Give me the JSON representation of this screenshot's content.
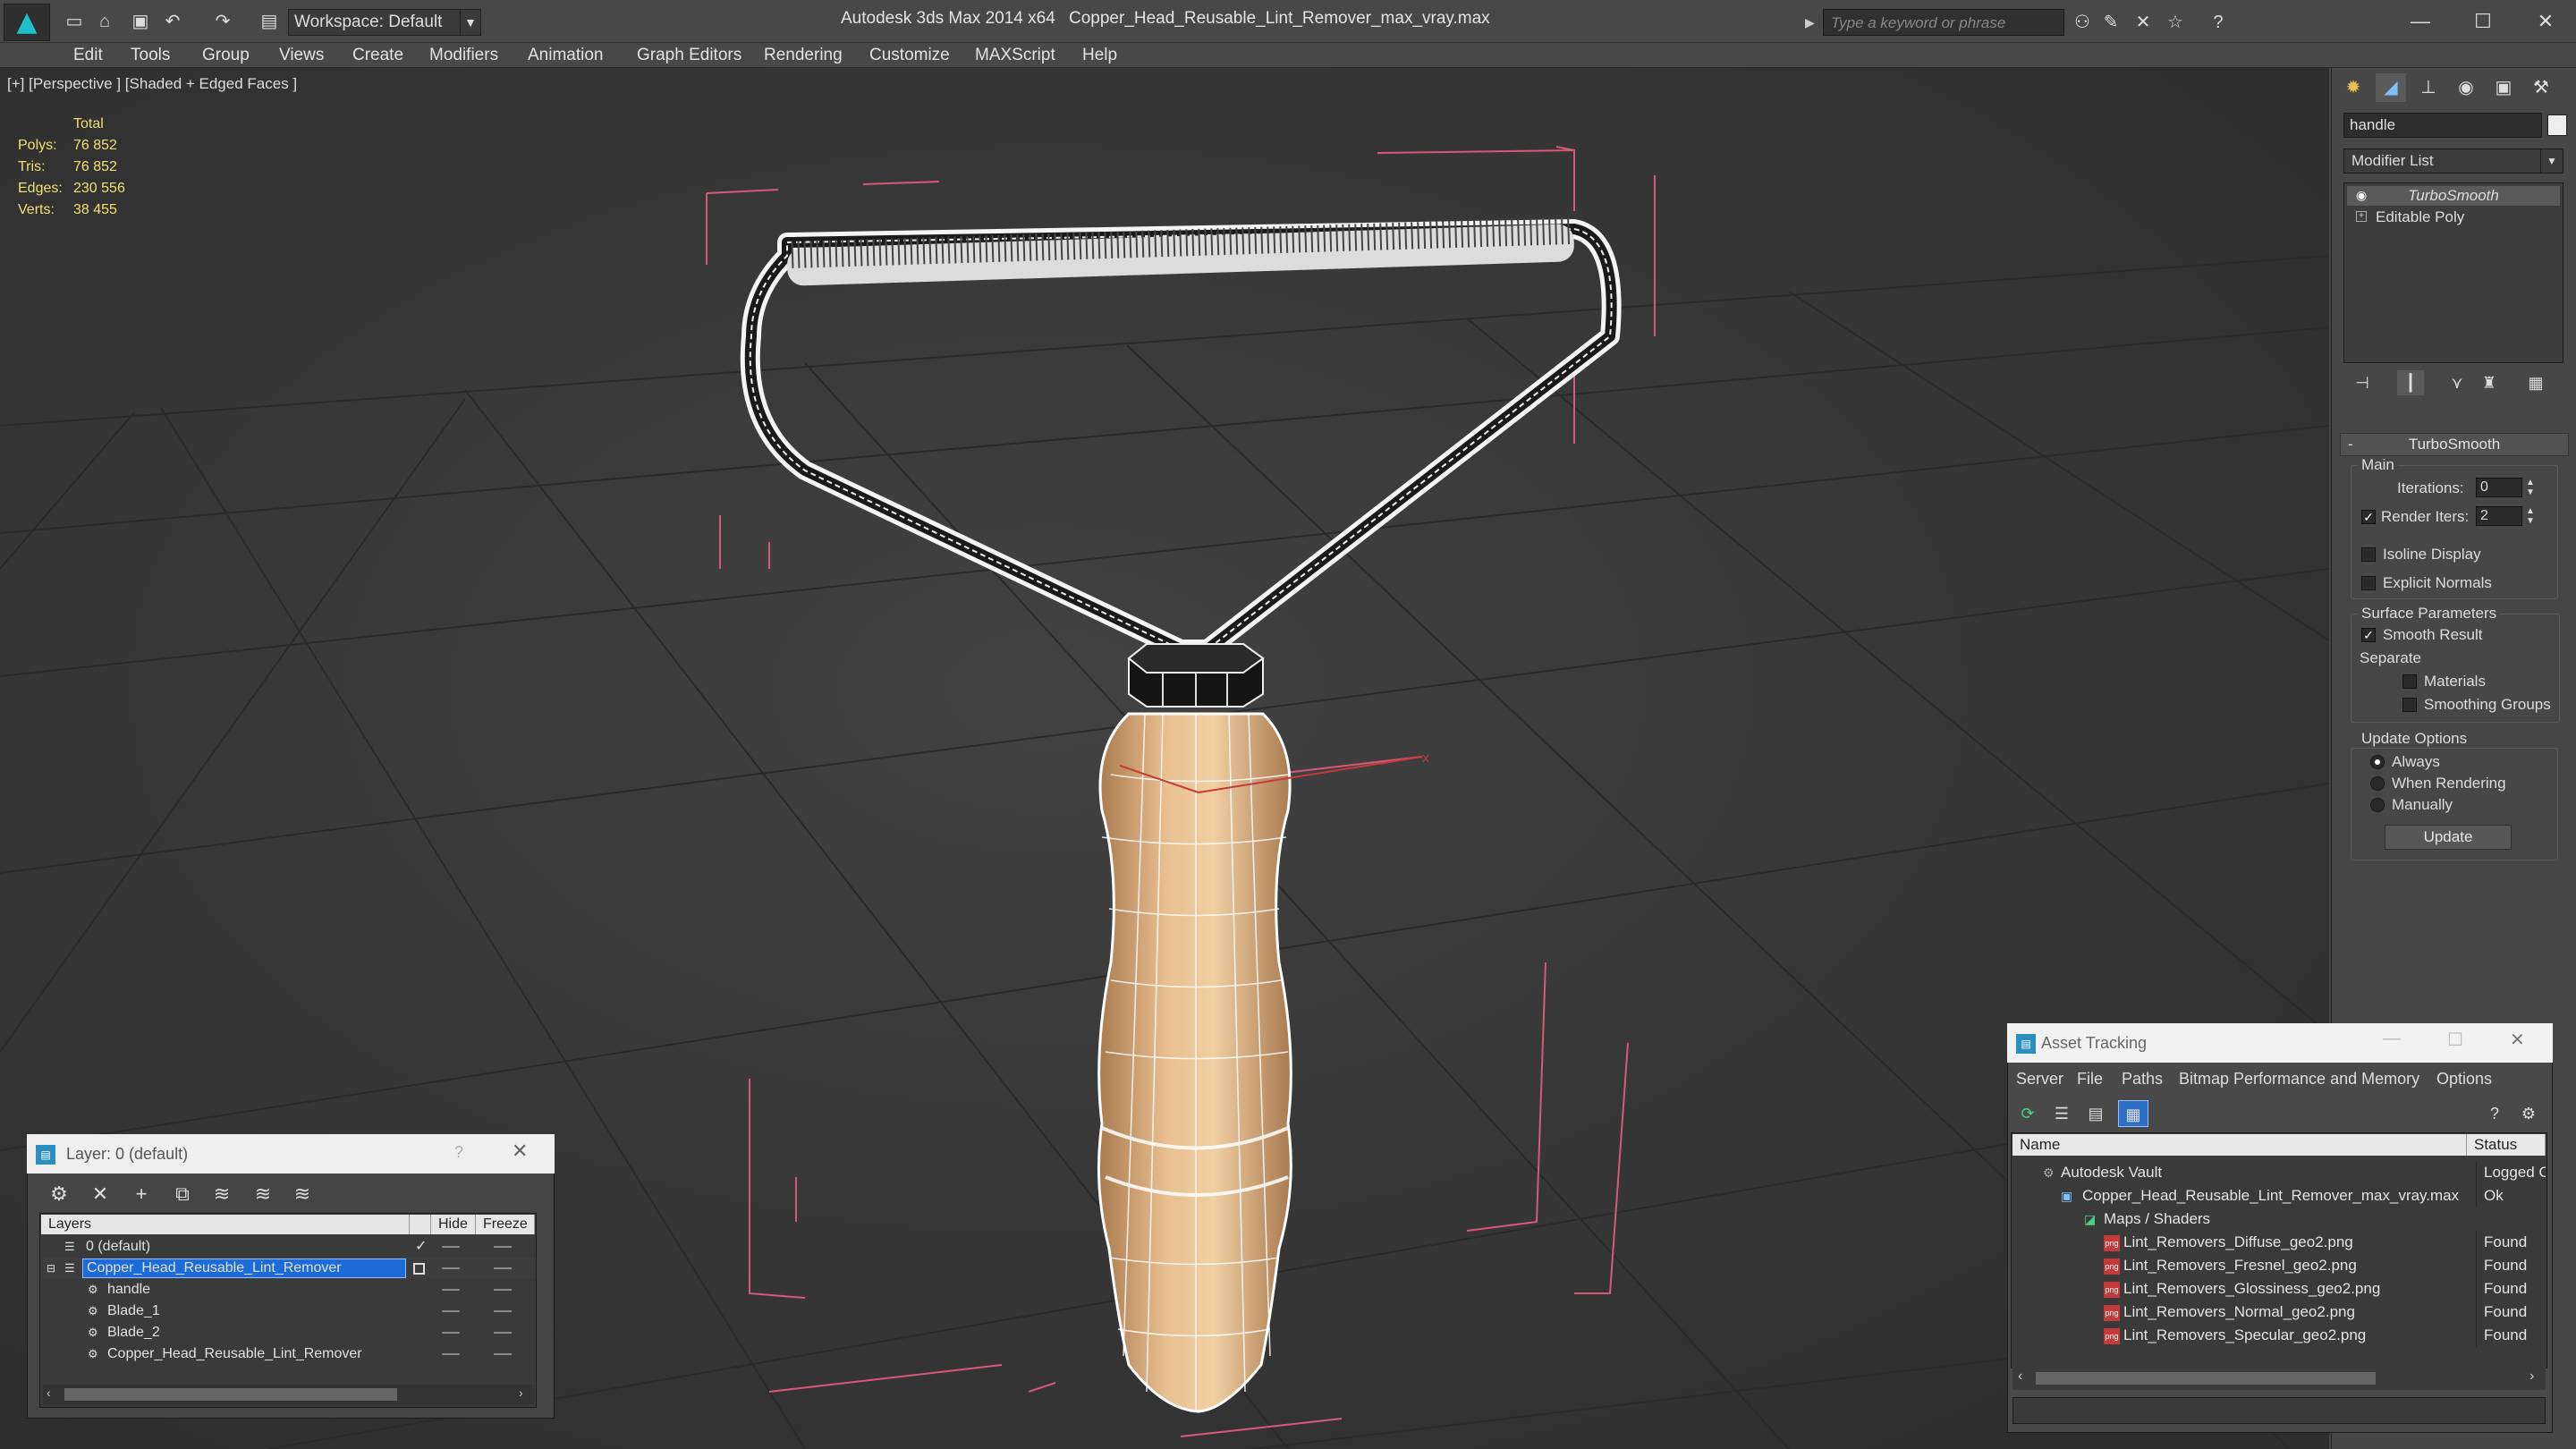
{
  "titlebar": {
    "workspace": "Workspace: Default",
    "app_title": "Autodesk 3ds Max  2014 x64",
    "file_title": "Copper_Head_Reusable_Lint_Remover_max_vray.max",
    "search_placeholder": "Type a keyword or phrase"
  },
  "menu": [
    "Edit",
    "Tools",
    "Group",
    "Views",
    "Create",
    "Modifiers",
    "Animation",
    "Graph Editors",
    "Rendering",
    "Customize",
    "MAXScript",
    "Help"
  ],
  "viewport": {
    "label": "[+] [Perspective ] [Shaded + Edged Faces ]",
    "stats": {
      "header": "Total",
      "rows": [
        {
          "label": "Polys:",
          "value": "76 852"
        },
        {
          "label": "Tris:",
          "value": "76 852"
        },
        {
          "label": "Edges:",
          "value": "230 556"
        },
        {
          "label": "Verts:",
          "value": "38 455"
        }
      ]
    }
  },
  "command_panel": {
    "object_name": "handle",
    "modifier_list": "Modifier List",
    "stack": [
      "TurboSmooth",
      "Editable Poly"
    ],
    "rollout_title": "TurboSmooth",
    "main_group": "Main",
    "iterations_label": "Iterations:",
    "iterations_value": "0",
    "render_iters_label": "Render Iters:",
    "render_iters_value": "2",
    "isoline_label": "Isoline Display",
    "explicit_normals_label": "Explicit Normals",
    "surface_group": "Surface Parameters",
    "smooth_result_label": "Smooth Result",
    "separate_label": "Separate",
    "materials_label": "Materials",
    "smoothing_groups_label": "Smoothing Groups",
    "update_group": "Update Options",
    "always_label": "Always",
    "when_rendering_label": "When Rendering",
    "manually_label": "Manually",
    "update_button": "Update"
  },
  "layer_dialog": {
    "title": "Layer: 0 (default)",
    "help": "?",
    "columns": [
      "Layers",
      "Hide",
      "Freeze"
    ],
    "rows": [
      "0 (default)",
      "Copper_Head_Reusable_Lint_Remover",
      "handle",
      "Blade_1",
      "Blade_2",
      "Copper_Head_Reusable_Lint_Remover"
    ]
  },
  "asset_tracking": {
    "title": "Asset Tracking",
    "menu": [
      "Server",
      "File",
      "Paths",
      "Bitmap Performance and Memory",
      "Options"
    ],
    "columns": [
      "Name",
      "Status"
    ],
    "rows": [
      {
        "name": "Autodesk Vault",
        "status": "Logged O"
      },
      {
        "name": "Copper_Head_Reusable_Lint_Remover_max_vray.max",
        "status": "Ok"
      },
      {
        "name": "Maps / Shaders",
        "status": ""
      },
      {
        "name": "Lint_Removers_Diffuse_geo2.png",
        "status": "Found"
      },
      {
        "name": "Lint_Removers_Fresnel_geo2.png",
        "status": "Found"
      },
      {
        "name": "Lint_Removers_Glossiness_geo2.png",
        "status": "Found"
      },
      {
        "name": "Lint_Removers_Normal_geo2.png",
        "status": "Found"
      },
      {
        "name": "Lint_Removers_Specular_geo2.png",
        "status": "Found"
      }
    ]
  }
}
